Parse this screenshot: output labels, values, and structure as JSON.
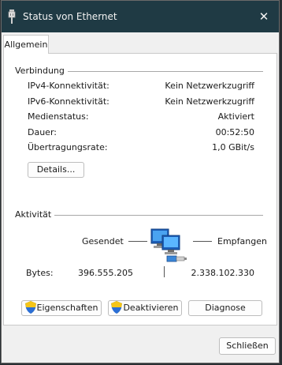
{
  "window": {
    "title": "Status von Ethernet",
    "close_glyph": "✕"
  },
  "tabs": [
    {
      "label": "Allgemein",
      "selected": true
    }
  ],
  "connection": {
    "heading": "Verbindung",
    "rows": [
      {
        "label": "IPv4-Konnektivität:",
        "value": "Kein Netzwerkzugriff"
      },
      {
        "label": "IPv6-Konnektivität:",
        "value": "Kein Netzwerkzugriff"
      },
      {
        "label": "Medienstatus:",
        "value": "Aktiviert"
      },
      {
        "label": "Dauer:",
        "value": "00:52:50"
      },
      {
        "label": "Übertragungsrate:",
        "value": "1,0 GBit/s"
      }
    ],
    "details_button": "Details..."
  },
  "activity": {
    "heading": "Aktivität",
    "sent_label": "Gesendet",
    "received_label": "Empfangen",
    "bytes_label": "Bytes:",
    "bytes_sent": "396.555.205",
    "bytes_received": "2.338.102.330"
  },
  "buttons": {
    "properties": "Eigenschaften",
    "disable": "Deaktivieren",
    "diagnose": "Diagnose",
    "close": "Schließen"
  },
  "icons": {
    "title": "ethernet-cable-icon",
    "activity": "network-computers-icon",
    "shield": "uac-shield-icon"
  },
  "colors": {
    "titlebar": "#1f3a44",
    "window_bg": "#f0f0f0",
    "panel_bg": "#ffffff"
  }
}
